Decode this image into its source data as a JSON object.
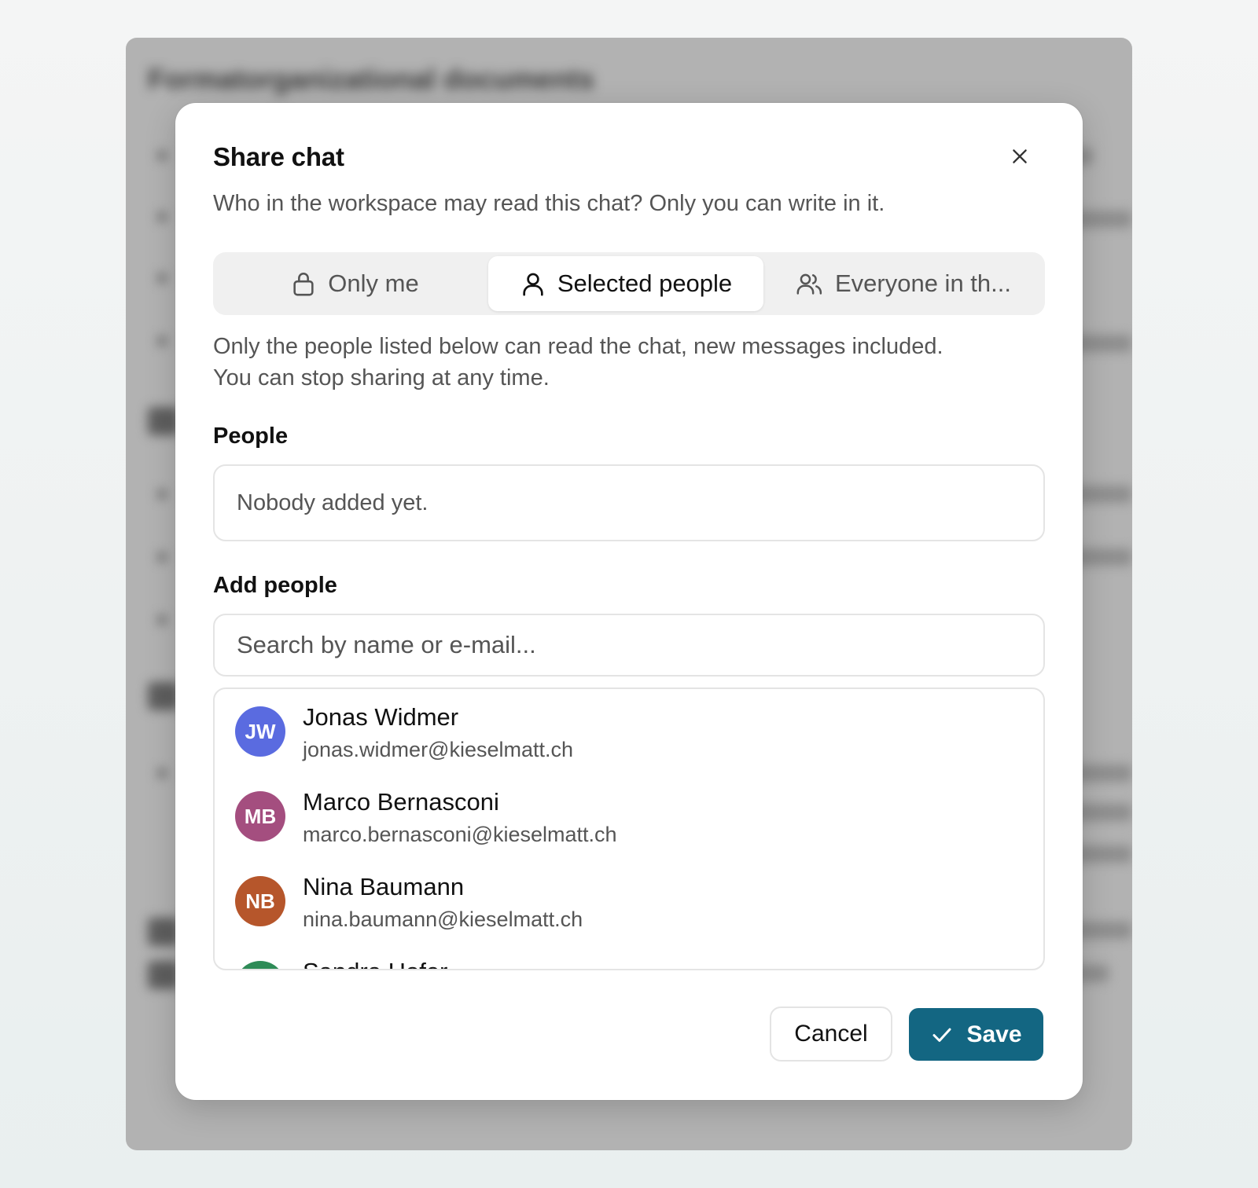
{
  "background": {
    "title": "Formatorganizational documents"
  },
  "dialog": {
    "title": "Share chat",
    "subtitle": "Who in the workspace may read this chat? Only you can write in it.",
    "close_icon": "close-icon",
    "visibility_options": [
      {
        "label": "Only me",
        "icon": "lock-icon",
        "selected": false
      },
      {
        "label": "Selected people",
        "icon": "user-icon",
        "selected": true
      },
      {
        "label": "Everyone in th...",
        "icon": "users-icon",
        "selected": false
      }
    ],
    "description_line1": "Only the people listed below can read the chat, new messages included.",
    "description_line2": "You can stop sharing at any time.",
    "people_label": "People",
    "people_empty": "Nobody added yet.",
    "add_people_label": "Add people",
    "search": {
      "placeholder": "Search by name or e-mail...",
      "value": ""
    },
    "suggestions": [
      {
        "initials": "JW",
        "name": "Jonas Widmer",
        "email": "jonas.widmer@kieselmatt.ch",
        "color": "#5a6be0"
      },
      {
        "initials": "MB",
        "name": "Marco Bernasconi",
        "email": "marco.bernasconi@kieselmatt.ch",
        "color": "#a44e7f"
      },
      {
        "initials": "NB",
        "name": "Nina Baumann",
        "email": "nina.baumann@kieselmatt.ch",
        "color": "#b6562b"
      },
      {
        "initials": "",
        "name": "Sandra Hofer",
        "email": "",
        "color": "#2e8b57"
      }
    ],
    "cancel_label": "Cancel",
    "save_label": "Save"
  },
  "colors": {
    "accent": "#136682",
    "overlay": "#b2b2b2"
  }
}
